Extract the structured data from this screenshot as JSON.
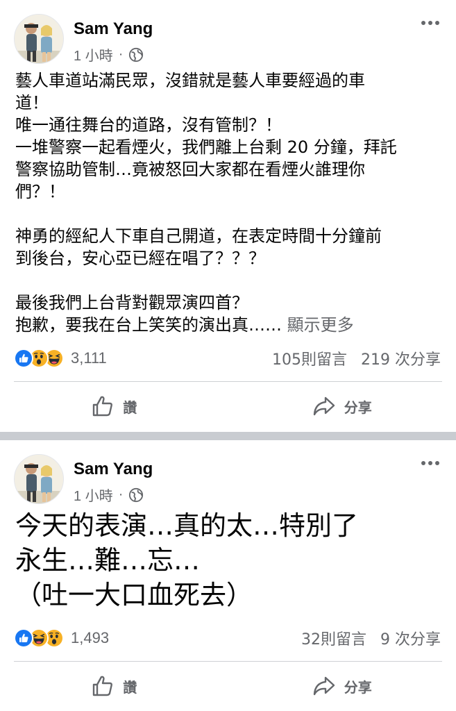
{
  "posts": [
    {
      "author": "Sam Yang",
      "time": "1 小時",
      "dot": "·",
      "privacy_icon": "globe-icon",
      "text": "藝人車道站滿民眾，沒錯就是藝人車要經過的車\n道！\n唯一通往舞台的道路，沒有管制？！\n一堆警察一起看煙火，我們離上台剩 20 分鐘，拜託\n警察協助管制…竟被怒回大家都在看煙火誰理你\n們？！\n\n神勇的經紀人下車自己開道，在表定時間十分鐘前\n到後台，安心亞已經在唱了？？？\n\n最後我們上台背對觀眾演四首？\n抱歉，要我在台上笑笑的演出真……",
      "see_more": " 顯示更多",
      "reactions": [
        "like-icon",
        "wow-icon",
        "haha-icon"
      ],
      "reaction_count": "3,111",
      "comments": "105則留言",
      "shares": "219 次分享",
      "like_label": "讚",
      "share_label": "分享"
    },
    {
      "author": "Sam Yang",
      "time": "1 小時",
      "dot": "·",
      "privacy_icon": "globe-icon",
      "text": "今天的表演…真的太…特別了\n永生…難…忘…\n（吐一大口血死去）",
      "reactions": [
        "like-icon",
        "haha-icon",
        "wow-icon"
      ],
      "reaction_count": "1,493",
      "comments": "32則留言",
      "shares": "9 次分享",
      "like_label": "讚",
      "share_label": "分享"
    }
  ],
  "colors": {
    "like": "#1877f2",
    "emoji": "#f7b125",
    "secondary_text": "#65676b",
    "divider": "#c9ccd1"
  }
}
